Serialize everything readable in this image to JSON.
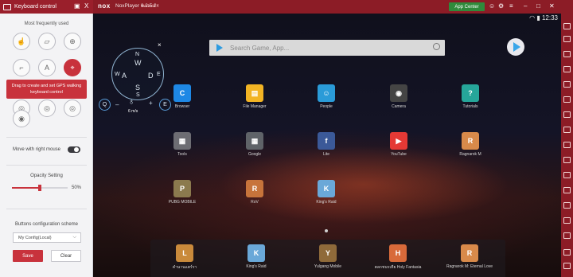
{
  "titlebar": {
    "panel_title": "Keyboard control",
    "pin_icon": "pin-icon",
    "close_glyph": "X",
    "brand": "nox",
    "version": "NoxPlayer 6.2.5.2",
    "android": "Android 4",
    "app_center": "App Center",
    "accent": "#8c1c26"
  },
  "panel": {
    "section_title": "Most frequently used",
    "tooltip": "Drag to create and set GPS walking keyboard control",
    "move_with_right_mouse": "Move with right mouse",
    "opacity_title": "Opacity Setting",
    "opacity_value": "50%",
    "opacity_fraction": 0.5,
    "scheme_title": "Buttons configuration scheme",
    "scheme_selected": "My Config(Local)",
    "save_label": "Save",
    "clear_label": "Clear"
  },
  "screen": {
    "clock": "12:33",
    "search_placeholder": "Search Game, App...",
    "compass": {
      "n": "N",
      "w": "W",
      "s": "S",
      "e": "E",
      "a": "A",
      "d": "D",
      "w2": "W",
      "s2": "S",
      "close": "×"
    },
    "controls": {
      "q": "Q",
      "minus": "–",
      "plus": "+",
      "e": "E",
      "speed": "6 m/s"
    },
    "apps_row1": [
      "Browser",
      "File Manager",
      "People",
      "Camera",
      "Tutorials"
    ],
    "apps_row2": [
      "Tools",
      "Google",
      "Lite",
      "YouTube",
      "Ragnarok M"
    ],
    "apps_row3": [
      "PUBG MOBILE",
      "RoV",
      "King's Raid"
    ],
    "dock": [
      "คำนานแตร์รา",
      "King's Raid",
      "Yulgang Mobile",
      "ตลกชนรเทีย Holy Fantasia",
      "Ragnarok M: Eternal Love"
    ]
  }
}
